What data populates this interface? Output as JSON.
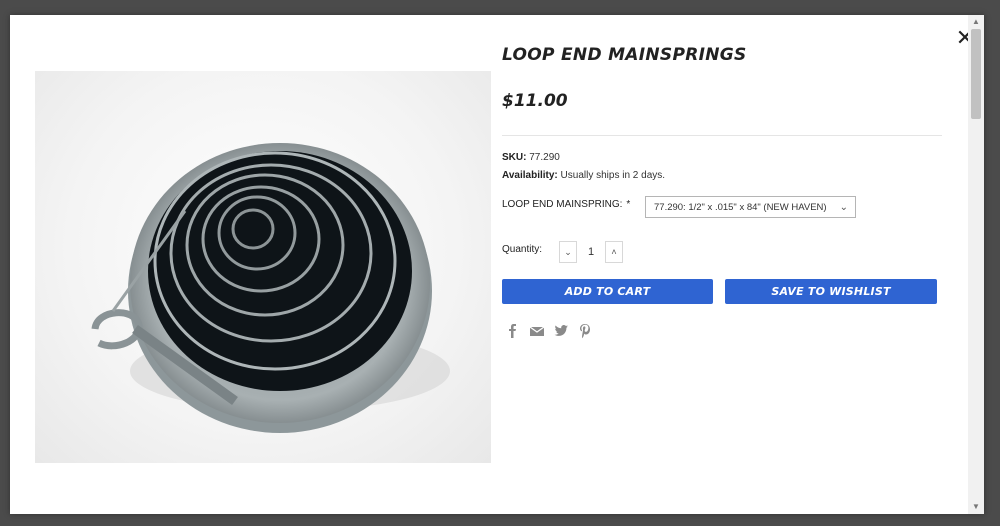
{
  "product": {
    "title": "LOOP END MAINSPRINGS",
    "price": "$11.00",
    "sku_label": "SKU:",
    "sku_value": "77.290",
    "availability_label": "Availability:",
    "availability_value": "Usually ships in 2 days.",
    "option_label": "LOOP END MAINSPRING:",
    "option_required": "*",
    "option_selected": "77.290: 1/2\" x .015\" x 84\" (NEW HAVEN)",
    "quantity_label": "Quantity:",
    "quantity_value": "1"
  },
  "buttons": {
    "add_to_cart": "ADD TO CART",
    "save_to_wishlist": "SAVE TO WISHLIST"
  },
  "icons": {
    "close": "close-icon",
    "share": [
      "facebook-icon",
      "email-icon",
      "twitter-icon",
      "pinterest-icon"
    ]
  },
  "colors": {
    "accent": "#2f64d2",
    "overlay": "#4b4b4b"
  }
}
